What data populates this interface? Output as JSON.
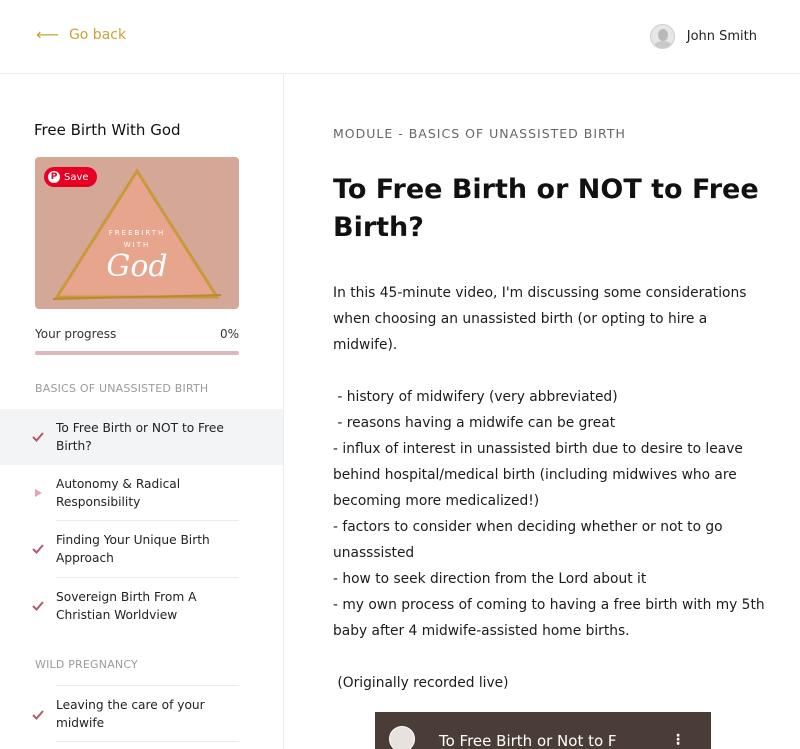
{
  "header": {
    "back_label": "Go back",
    "user_name": "John Smith"
  },
  "sidebar": {
    "course_title": "Free Birth With God",
    "thumbnail": {
      "save_label": "Save",
      "line1": "FREEBIRTH",
      "line2": "WITH",
      "line3": "God"
    },
    "progress_label": "Your progress",
    "progress_value": "0%",
    "progress_fraction": 0,
    "sections": [
      {
        "title": "BASICS OF UNASSISTED BIRTH",
        "lessons": [
          {
            "label": "To Free Birth or NOT to Free Birth?",
            "status": "complete",
            "active": true
          },
          {
            "label": "Autonomy & Radical Responsibility",
            "status": "current",
            "active": false
          },
          {
            "label": "Finding Your Unique Birth Approach",
            "status": "complete",
            "active": false
          },
          {
            "label": "Sovereign Birth From A Christian Worldview",
            "status": "complete",
            "active": false
          }
        ]
      },
      {
        "title": "WILD PREGNANCY",
        "lessons": [
          {
            "label": "Leaving the care of your midwife",
            "status": "complete",
            "active": false
          }
        ]
      }
    ],
    "colors": {
      "accent": "#b35a69",
      "gold": "#c8a43a"
    }
  },
  "main": {
    "module": "MODULE - BASICS OF UNASSISTED BIRTH",
    "title": "To Free Birth or NOT to Free Birth?",
    "paragraphs": [
      "In this 45-minute video, I'm discussing some considerations when choosing an unassisted birth (or opting to hire a midwife).",
      "",
      " - history of midwifery (very abbreviated)",
      " - reasons having a midwife can be great",
      "- influx of interest in unassisted birth due to desire to leave behind hospital/medical birth (including midwives who are becoming more medicalized!)",
      "- factors to consider when deciding whether or not to go unasssisted",
      "- how to seek direction from the Lord about it",
      "- my own process of coming to having a free birth with my 5th baby after 4 midwife-assisted home births.",
      "",
      " (Originally recorded live)"
    ],
    "video_title": "To Free Birth or Not to F"
  }
}
